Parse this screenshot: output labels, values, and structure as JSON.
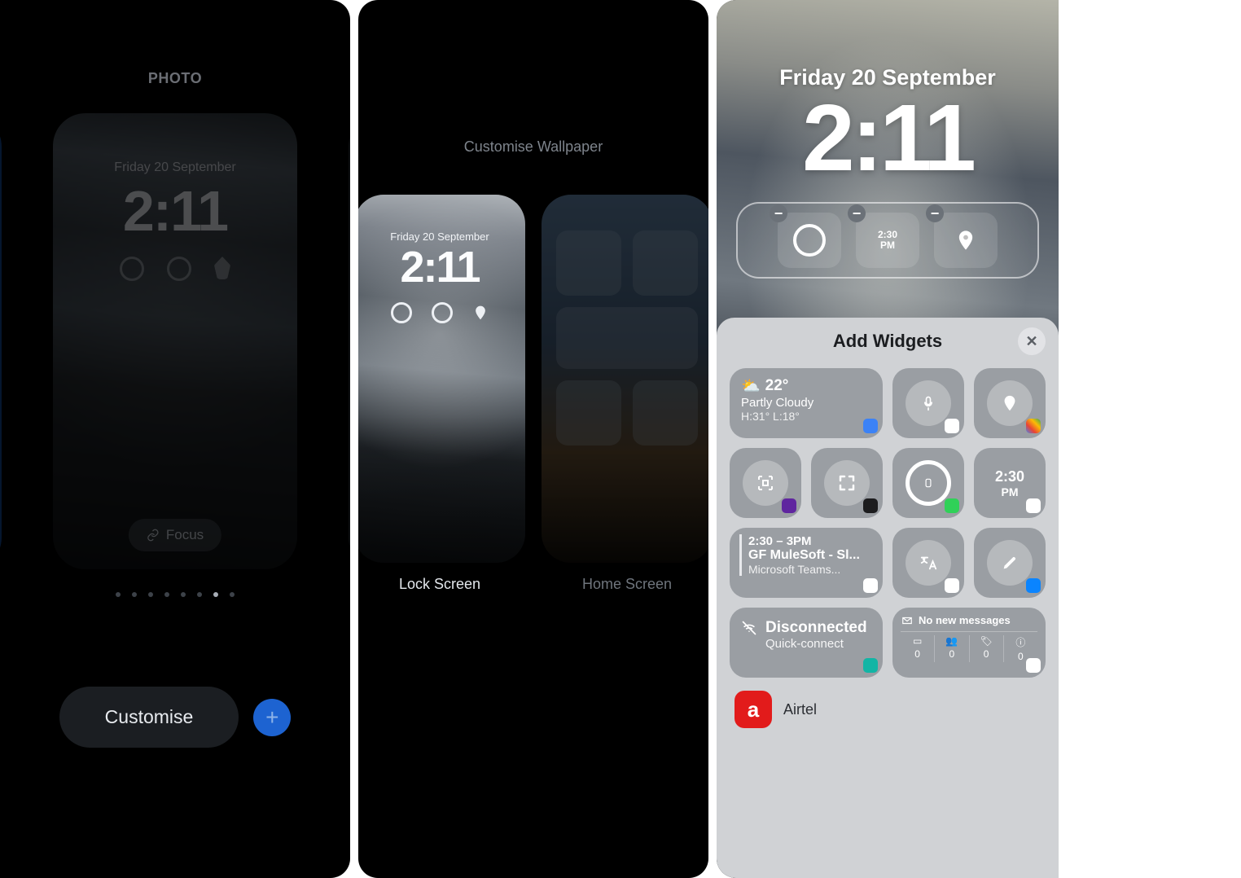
{
  "panel1": {
    "heading": "PHOTO",
    "date": "Friday 20 September",
    "time": "2:11",
    "focus_label": "Focus",
    "customise_label": "Customise"
  },
  "panel2": {
    "title": "Customise Wallpaper",
    "lock": {
      "label": "Lock Screen",
      "date": "Friday 20 September",
      "time": "2:11"
    },
    "home": {
      "label": "Home Screen"
    }
  },
  "panel3": {
    "date": "Friday 20 September",
    "time": "2:11",
    "slot_time": "2:30",
    "slot_pm": "PM",
    "sheet_title": "Add Widgets",
    "weather": {
      "temp": "22°",
      "cond": "Partly Cloudy",
      "hl": "H:31° L:18°"
    },
    "cal_time": {
      "t": "2:30",
      "pm": "PM"
    },
    "event": {
      "time": "2:30 – 3PM",
      "title": "GF MuleSoft - Sl...",
      "sub": "Microsoft Teams..."
    },
    "disc": {
      "title": "Disconnected",
      "sub": "Quick-connect"
    },
    "mail": {
      "header": "No new messages",
      "vals": [
        "0",
        "0",
        "0",
        "0"
      ]
    },
    "airtel_label": "Airtel"
  },
  "colors": {
    "badge_weather": "#3b82f6",
    "badge_google": "#ffffff",
    "badge_maps": "#ffffff",
    "badge_phonepe": "#5f259f",
    "badge_msg": "#30d158",
    "badge_cal": "#ffffff",
    "badge_arrow": "#0a84ff",
    "badge_surfshark": "#12b5a5",
    "badge_gmail": "#ffffff"
  }
}
